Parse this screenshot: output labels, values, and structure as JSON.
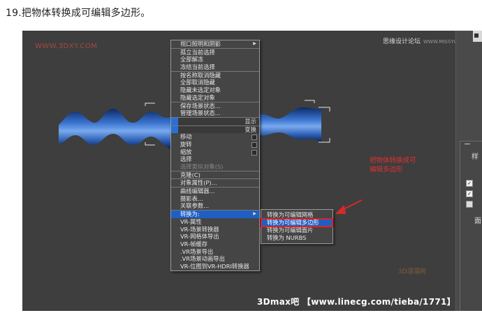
{
  "heading": "19.把物体转换成可编辑多边形。",
  "viewport": {
    "watermark": "WWW.3DXY.COM",
    "site_name": "思缘设计论坛",
    "site_url": "WWW.MISSYUAN.COM",
    "annotation_line1": "把物体转换成可",
    "annotation_line2": "编辑多边形",
    "footer": "3Dmax吧 【www.linecg.com/tieba/1771】",
    "logo": "3D溜溜网"
  },
  "context_menu": {
    "items": [
      {
        "label": "视口照明和阴影",
        "arrow": "▶"
      },
      {
        "label": "孤立当前选择"
      },
      {
        "label": "全部解冻"
      },
      {
        "label": "冻结当前选择"
      },
      {
        "label": "按名称取消隐藏"
      },
      {
        "label": "全部取消隐藏"
      },
      {
        "label": "隐藏未选定对象"
      },
      {
        "label": "隐藏选定对象"
      },
      {
        "label": "保存场景状态..."
      },
      {
        "label": "管理场景状态..."
      },
      {
        "label": "显示"
      },
      {
        "label": "变换"
      },
      {
        "label": "移动"
      },
      {
        "label": "旋转"
      },
      {
        "label": "缩放"
      },
      {
        "label": "选择"
      },
      {
        "label": "选择类似对象(S)"
      },
      {
        "label": "克隆(C)"
      },
      {
        "label": "对象属性(P)..."
      },
      {
        "label": "曲线编辑器..."
      },
      {
        "label": "摄影表..."
      },
      {
        "label": "关联参数..."
      },
      {
        "label": "转换为:",
        "arrow": "▶"
      },
      {
        "label": "VR-属性"
      },
      {
        "label": "VR-场景转换器"
      },
      {
        "label": "VR-网格体导出"
      },
      {
        "label": "VR-帧缓存"
      },
      {
        "label": ".VR场景导出"
      },
      {
        "label": ".VR场景动画导出"
      },
      {
        "label": "VR-位图到VR-HDRI转换器"
      }
    ]
  },
  "convert_submenu": {
    "items": [
      {
        "label": "转换为可编辑网格"
      },
      {
        "label": "转换为可编辑多边形"
      },
      {
        "label": "转换为可编辑面片"
      },
      {
        "label": "转换为 NURBS"
      }
    ]
  },
  "right_panel": {
    "tab_label": "样",
    "group_label": "面"
  },
  "colors": {
    "viewport_bg": "#3e3e3e",
    "highlight": "#1f5fc2",
    "annotation_red": "#e23030",
    "object_blue": "#4a86d8"
  }
}
